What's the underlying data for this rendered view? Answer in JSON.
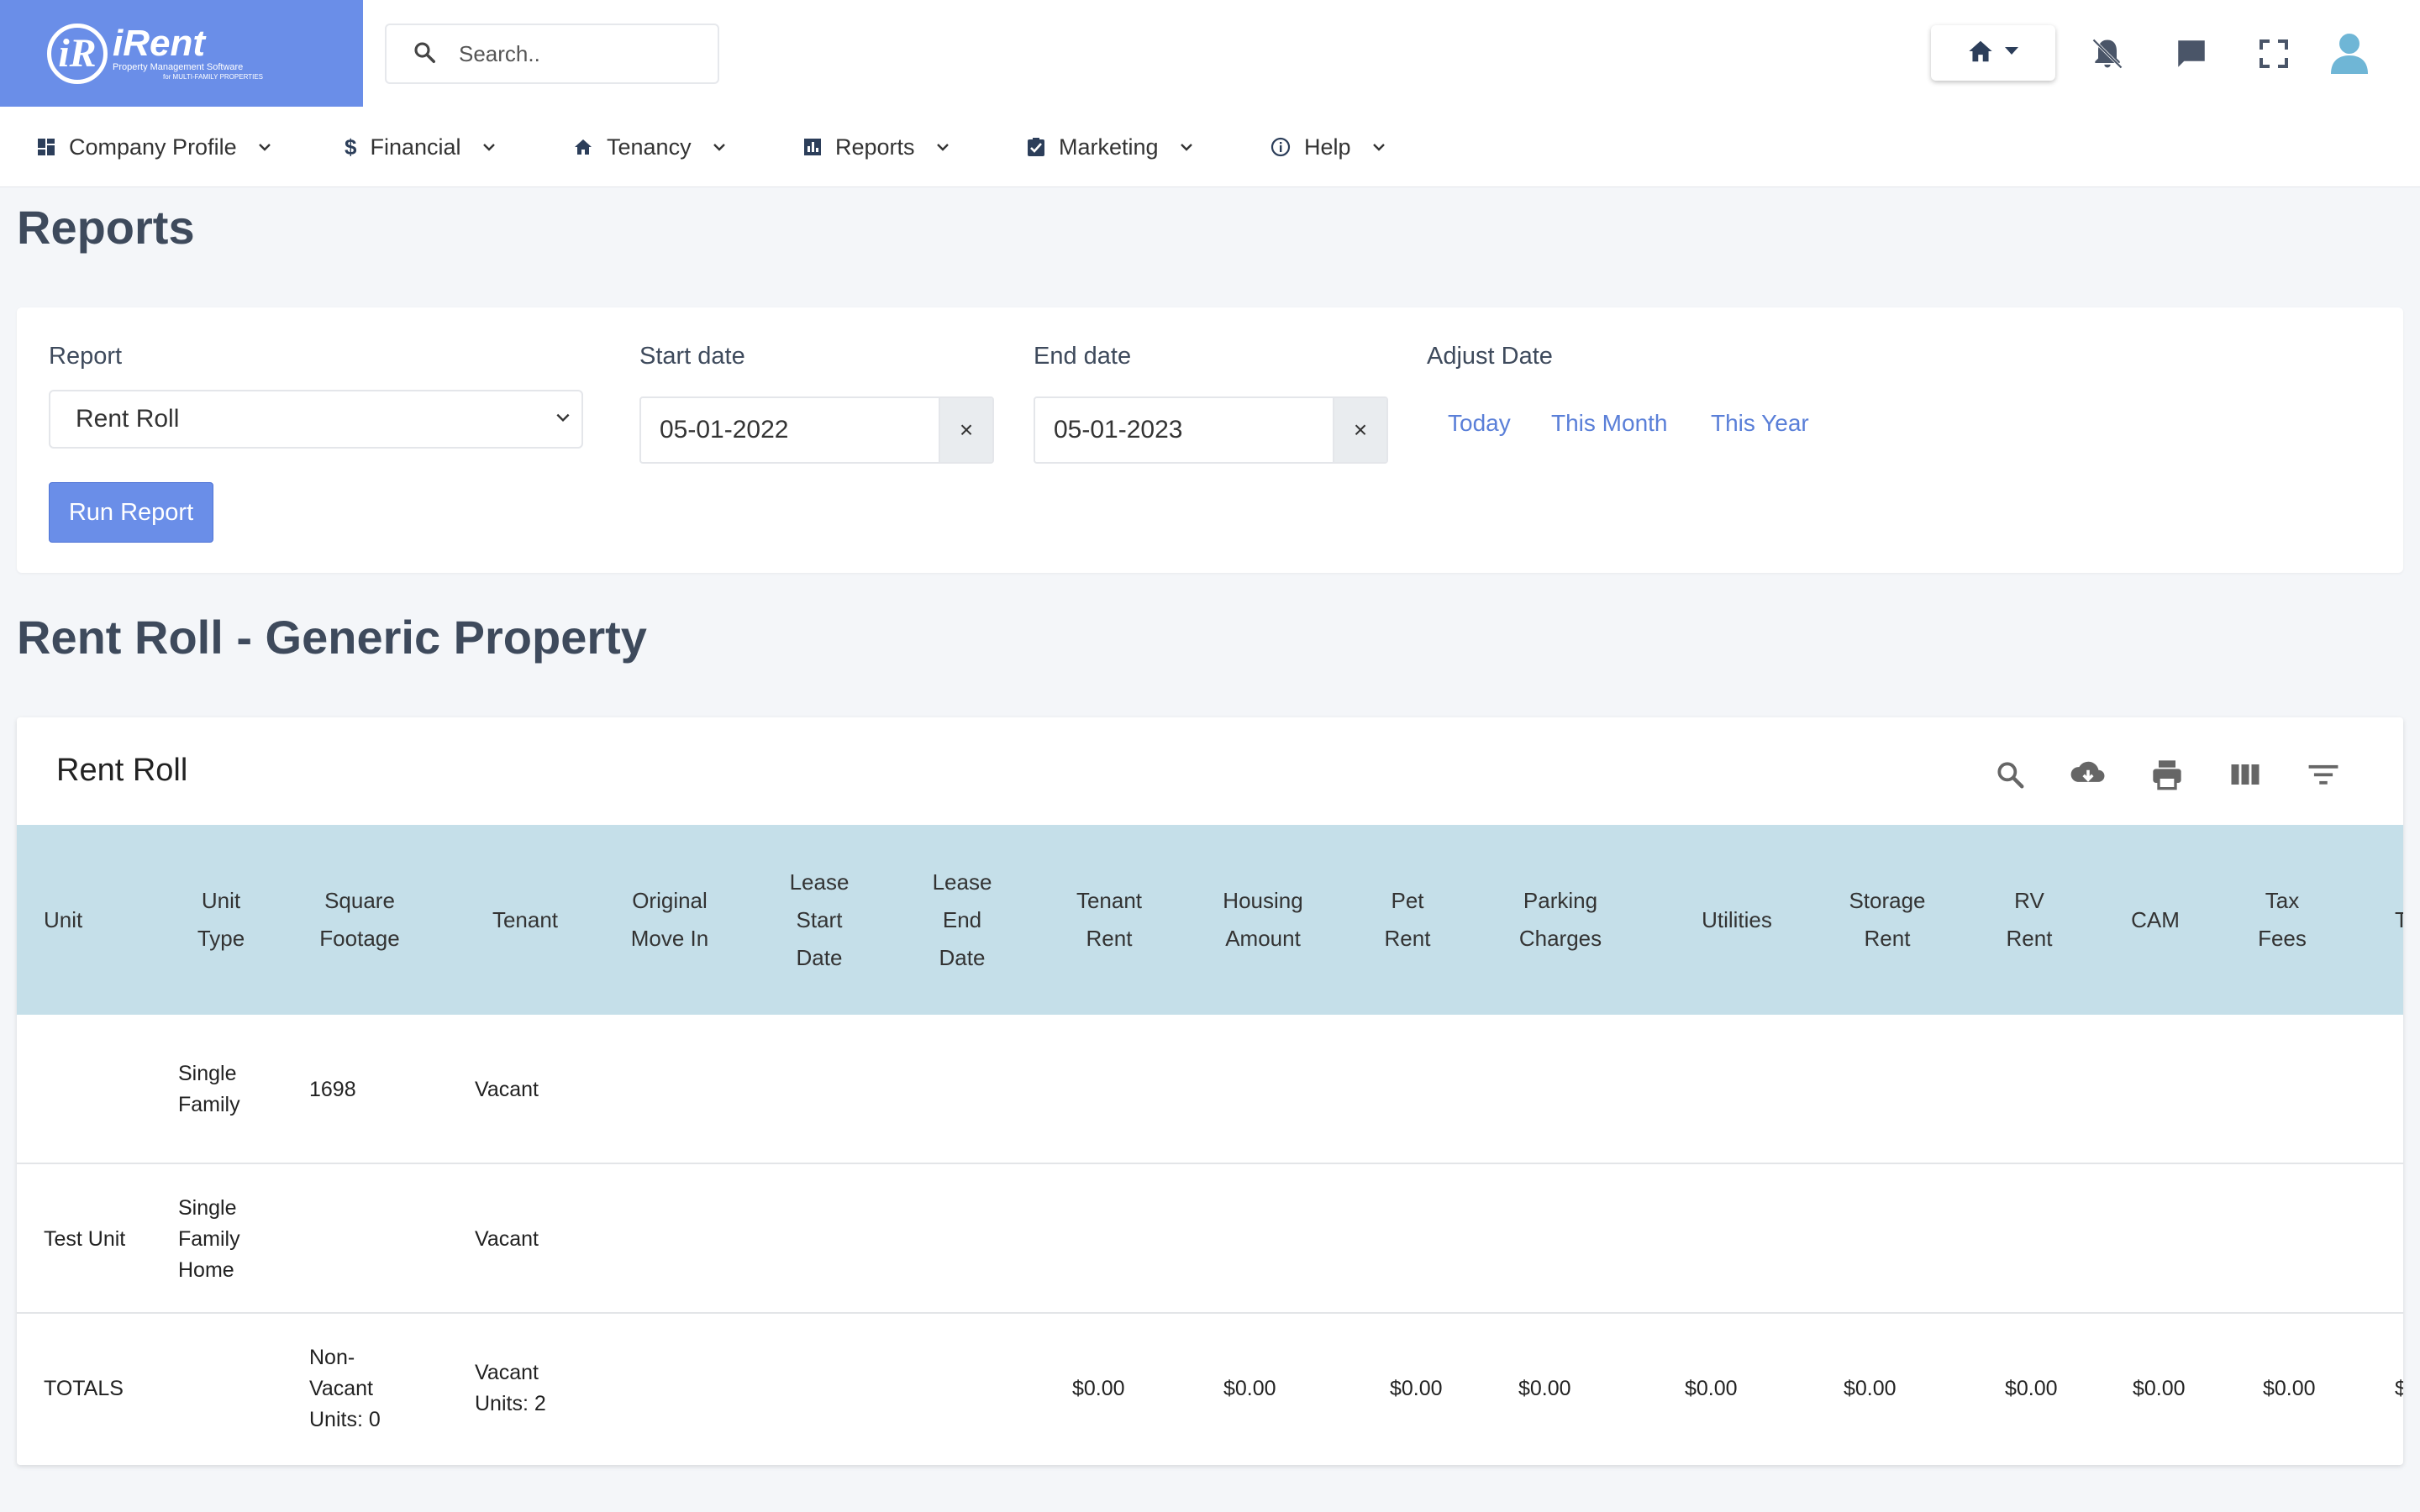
{
  "app": {
    "logo_mark": "iR",
    "logo_name": "iRent",
    "logo_tagline": "Property Management Software",
    "logo_tagline2": "for MULTI-FAMILY PROPERTIES"
  },
  "search": {
    "placeholder": "Search.."
  },
  "topbar_icons": [
    "home-icon",
    "bell-icon",
    "chat-icon",
    "fullscreen-icon",
    "user-icon"
  ],
  "nav": {
    "items": [
      {
        "label": "Company Profile",
        "icon": "dashboard-icon"
      },
      {
        "label": "Financial",
        "icon": "dollar-icon"
      },
      {
        "label": "Tenancy",
        "icon": "home-icon"
      },
      {
        "label": "Reports",
        "icon": "chart-icon"
      },
      {
        "label": "Marketing",
        "icon": "checkbox-icon"
      },
      {
        "label": "Help",
        "icon": "info-icon"
      }
    ]
  },
  "page": {
    "title": "Reports"
  },
  "filters": {
    "report_label": "Report",
    "report_value": "Rent Roll",
    "start_label": "Start date",
    "start_value": "05-01-2022",
    "end_label": "End date",
    "end_value": "05-01-2023",
    "clear_symbol": "×",
    "adjust_label": "Adjust Date",
    "adjust_links": [
      "Today",
      "This Month",
      "This Year"
    ],
    "run_label": "Run Report"
  },
  "section": {
    "title": "Rent Roll - Generic Property"
  },
  "table": {
    "title": "Rent Roll",
    "tools": [
      "search-icon",
      "download-icon",
      "print-icon",
      "columns-icon",
      "filter-icon"
    ],
    "columns": [
      "Unit",
      "Unit Type",
      "Square Footage",
      "Tenant",
      "Original Move In",
      "Lease Start Date",
      "Lease End Date",
      "Tenant Rent",
      "Housing Amount",
      "Pet Rent",
      "Parking Charges",
      "Utilities",
      "Storage Rent",
      "RV Rent",
      "CAM",
      "Tax Fees",
      "T F"
    ],
    "rows": [
      {
        "unit": "",
        "unit_type": "Single Family",
        "sqft": "1698",
        "tenant": "Vacant"
      },
      {
        "unit": "Test Unit",
        "unit_type": "Single Family Home",
        "sqft": "",
        "tenant": "Vacant"
      }
    ],
    "totals": {
      "label": "TOTALS",
      "sqft": "Non-Vacant Units: 0",
      "tenant": "Vacant Units: 2",
      "tenant_rent": "$0.00",
      "housing_amount": "$0.00",
      "pet_rent": "$0.00",
      "parking_charges": "$0.00",
      "utilities": "$0.00",
      "storage_rent": "$0.00",
      "rv_rent": "$0.00",
      "cam": "$0.00",
      "tax_fees": "$0.00",
      "next": "$"
    }
  },
  "colors": {
    "accent": "#6a8ee8",
    "table_header": "#c5dfe9",
    "link": "#5a7fd8",
    "heading": "#3e4a5c"
  }
}
